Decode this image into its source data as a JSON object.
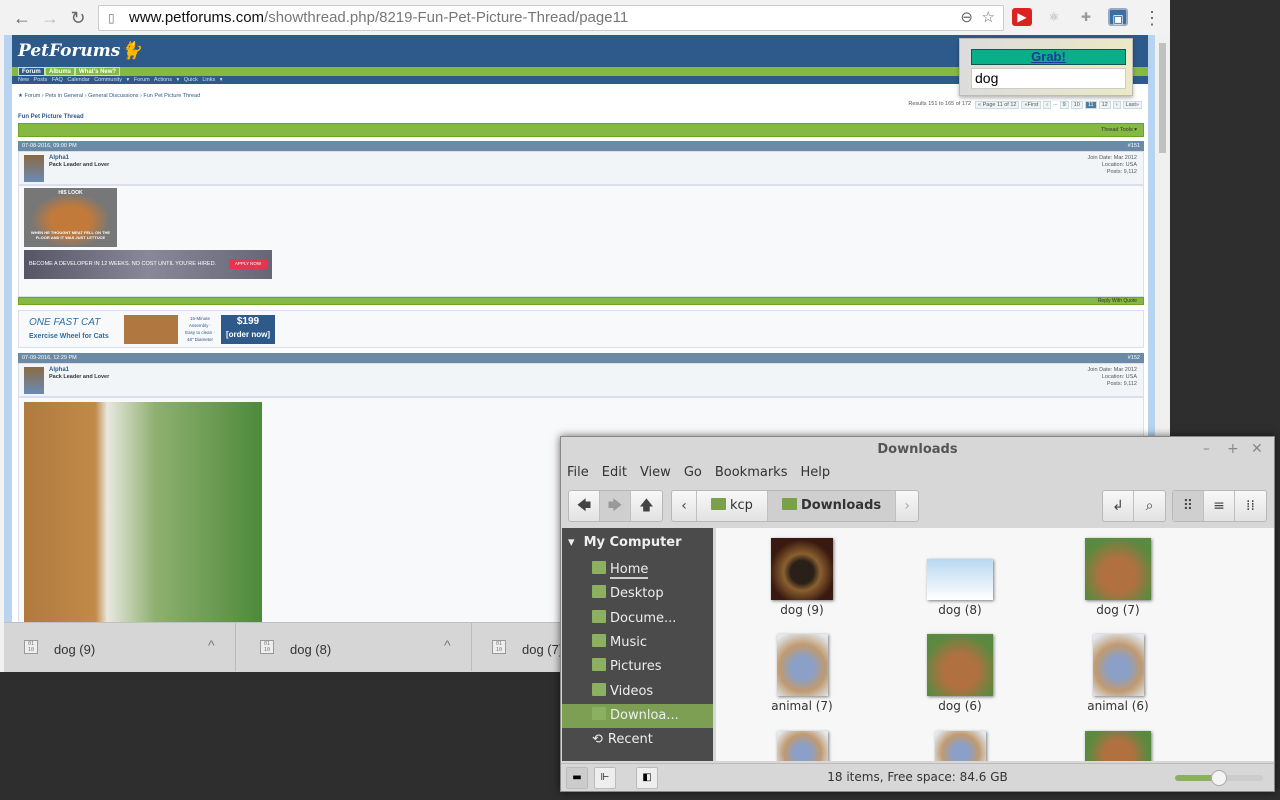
{
  "browser": {
    "url_host": "www.petforums.com",
    "url_path": "/showthread.php/8219-Fun-Pet-Picture-Thread/page11"
  },
  "forum": {
    "logo": "PetForums",
    "tabs": [
      "Forum",
      "Albums",
      "What's New?"
    ],
    "subnav": "New Posts  FAQ  Calendar  Community ▾  Forum Actions ▾  Quick Links ▾",
    "breadcrumb": [
      "Forum",
      "Pets in General",
      "General Discussions",
      "Fun Pet Picture Thread"
    ],
    "results": "Results 151 to 165 of 172",
    "pager": [
      "« Page 11 of 12",
      "«First",
      "‹",
      "...",
      "9",
      "10",
      "11",
      "12",
      "›",
      "Last»"
    ],
    "current_page": "11",
    "thread_title": "Fun Pet Picture Thread",
    "thread_tools": "Thread Tools ▾",
    "reply_with_quote": "Reply With Quote",
    "posts": [
      {
        "date": "07-08-2016,   09:00 PM",
        "num": "#151",
        "user": "Alpha1",
        "title": "Pack Leader and Lover",
        "join": "Join Date:  Mar 2012",
        "location": "Location:  USA",
        "posts": "Posts:  9,112"
      },
      {
        "date": "07-09-2016,   12:29 PM",
        "num": "#152",
        "user": "Alpha1",
        "title": "Pack Leader and Lover",
        "join": "Join Date:  Mar 2012",
        "location": "Location:  USA",
        "posts": "Posts:  9,112"
      }
    ],
    "meme_top": "HIS LOOK",
    "meme_bottom": "WHEN HE THOUGHT MEAT FELL ON THE FLOOR AND IT WAS JUST LETTUCE",
    "ad1": "BECOME A DEVELOPER IN 12 WEEKS. NO COST UNTIL YOU'RE HIRED.",
    "ad1_button": "APPLY NOW",
    "ad2": {
      "brand": "ONE FAST CAT",
      "sub": "Exercise Wheel for Cats",
      "info": "16-Minute Assembly · Easy to clean · 48\" Diameter",
      "price": "$199",
      "cta": "[order now]"
    }
  },
  "popup": {
    "grab": "Grab!",
    "query": "dog"
  },
  "downloads": [
    "dog (9)",
    "dog (8)",
    "dog (7)"
  ],
  "filemanager": {
    "title": "Downloads",
    "menu": [
      "File",
      "Edit",
      "View",
      "Go",
      "Bookmarks",
      "Help"
    ],
    "path": [
      "kcp",
      "Downloads"
    ],
    "sidebar_header": "My Computer",
    "places": [
      "Home",
      "Desktop",
      "Docume...",
      "Music",
      "Pictures",
      "Videos",
      "Downloa...",
      "Recent"
    ],
    "selected": "Downloa...",
    "files": [
      "dog (9)",
      "dog (8)",
      "dog (7)",
      "animal (7)",
      "dog (6)",
      "animal (6)"
    ],
    "status": "18 items, Free space: 84.6 GB",
    "zoom_level": 0.45
  }
}
